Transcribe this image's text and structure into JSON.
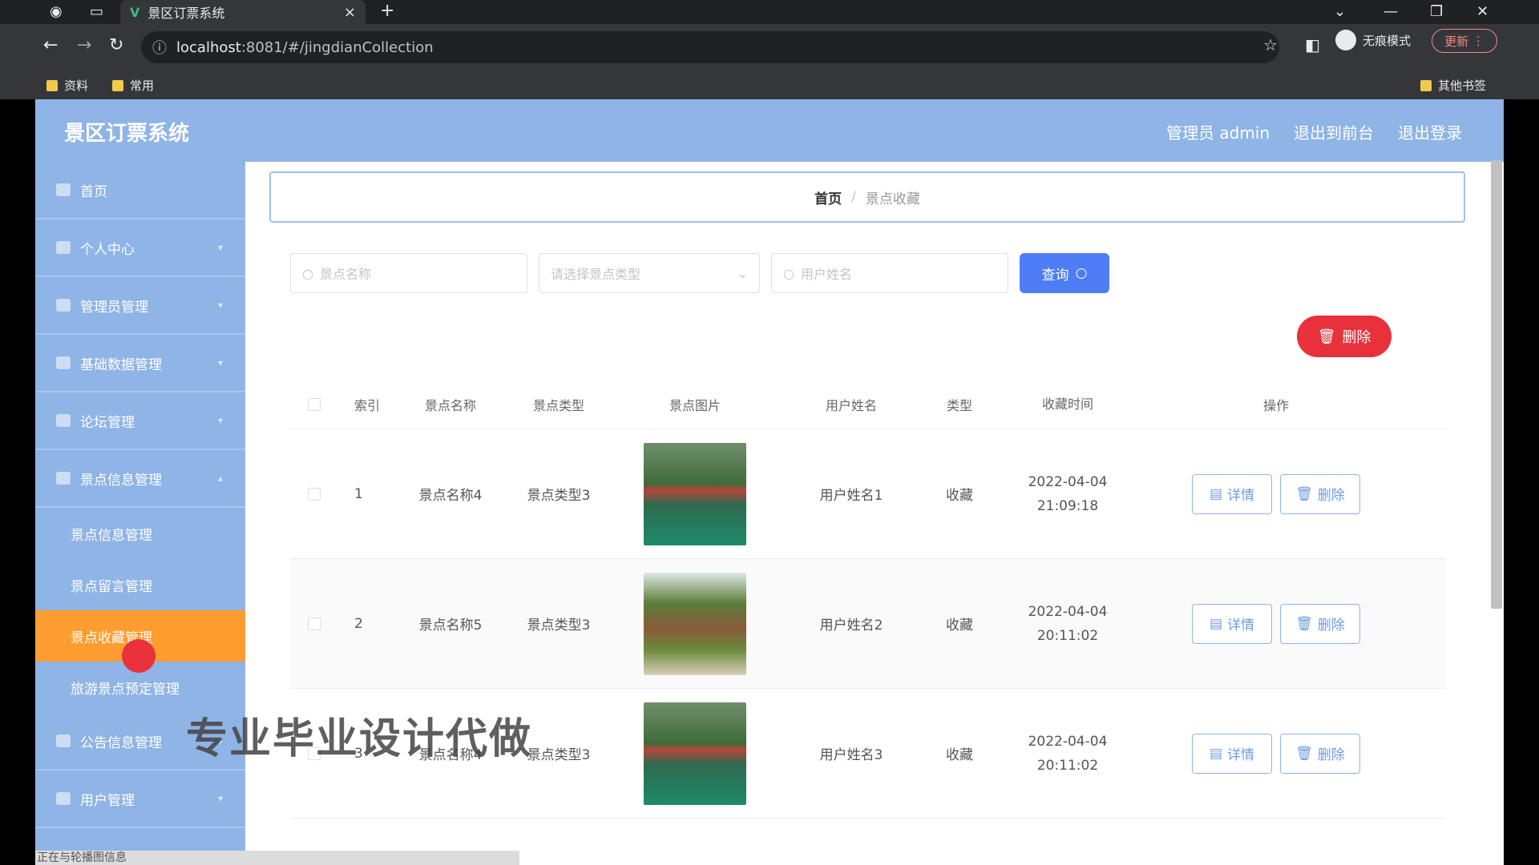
{
  "browser": {
    "tab_title": "景区订票系统",
    "tab_close": "×",
    "new_tab": "+",
    "url_host": "localhost",
    "url_rest": ":8081/#/jingdianCollection",
    "incognito_label": "无痕模式",
    "update_label": "更新",
    "bookmarks": [
      "资料",
      "常用"
    ],
    "other_bookmarks": "其他书签"
  },
  "app": {
    "brand": "景区订票系统",
    "user_label": "管理员 admin",
    "to_front": "退出到前台",
    "logout": "退出登录"
  },
  "sidebar": {
    "items": [
      {
        "label": "首页",
        "icon": "home-icon"
      },
      {
        "label": "个人中心",
        "icon": "user-icon"
      },
      {
        "label": "管理员管理",
        "icon": "admin-icon"
      },
      {
        "label": "基础数据管理",
        "icon": "data-icon"
      },
      {
        "label": "论坛管理",
        "icon": "forum-icon"
      },
      {
        "label": "景点信息管理",
        "icon": "scenic-icon"
      }
    ],
    "sub_items": [
      "景点信息管理",
      "景点留言管理",
      "景点收藏管理",
      "旅游景点预定管理"
    ],
    "after_items": [
      {
        "label": "公告信息管理",
        "icon": "notice-icon"
      },
      {
        "label": "用户管理",
        "icon": "users-icon"
      }
    ]
  },
  "breadcrumb": {
    "home": "首页",
    "sep": "/",
    "current": "景点收藏"
  },
  "search": {
    "name_placeholder": "景点名称",
    "type_placeholder": "请选择景点类型",
    "user_placeholder": "用户姓名",
    "query_label": "查询"
  },
  "delete_label": "删除",
  "table": {
    "headers": [
      "索引",
      "景点名称",
      "景点类型",
      "景点图片",
      "用户姓名",
      "类型",
      "收藏时间",
      "操作"
    ],
    "rows": [
      {
        "idx": "1",
        "name": "景点名称4",
        "type": "景点类型3",
        "user": "用户姓名1",
        "kind": "收藏",
        "date": "2022-04-04",
        "time": "21:09:18"
      },
      {
        "idx": "2",
        "name": "景点名称5",
        "type": "景点类型3",
        "user": "用户姓名2",
        "kind": "收藏",
        "date": "2022-04-04",
        "time": "20:11:02"
      },
      {
        "idx": "3",
        "name": "景点名称4",
        "type": "景点类型3",
        "user": "用户姓名3",
        "kind": "收藏",
        "date": "2022-04-04",
        "time": "20:11:02"
      }
    ],
    "detail_label": "详情",
    "delete_label": "删除"
  },
  "watermark": "专业毕业设计代做",
  "status_text": "正在与轮播图信息",
  "colors": {
    "accent": "#8fb4e6",
    "active": "#ff9d30",
    "danger": "#e8313b",
    "primary": "#4e7df7"
  }
}
